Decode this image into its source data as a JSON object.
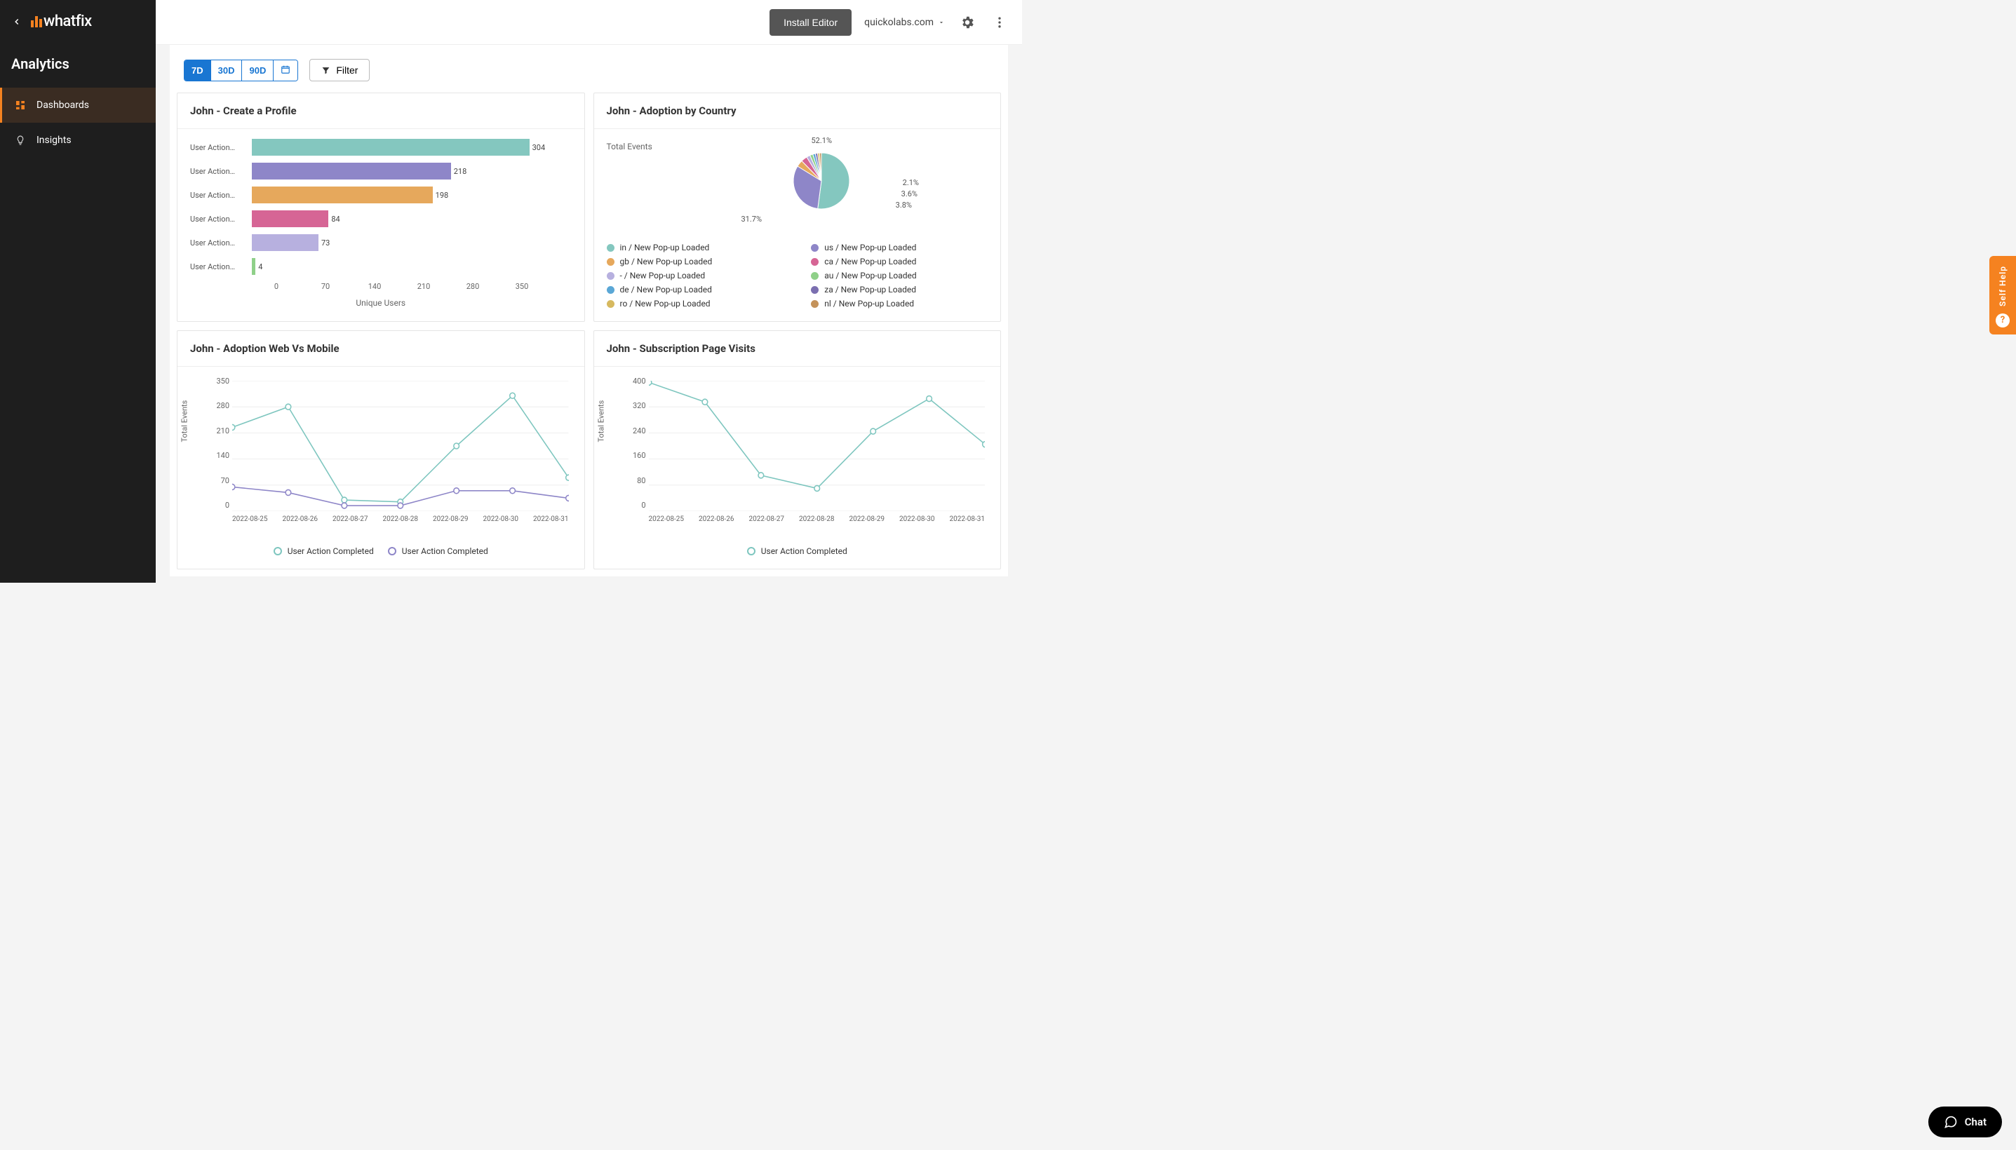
{
  "brand": {
    "name": "whatfix"
  },
  "sidebar": {
    "title": "Analytics",
    "items": [
      {
        "label": "Dashboards",
        "active": true
      },
      {
        "label": "Insights",
        "active": false
      }
    ]
  },
  "topbar": {
    "install_label": "Install Editor",
    "account": "quickolabs.com"
  },
  "filters": {
    "ranges": [
      "7D",
      "30D",
      "90D"
    ],
    "active_range": "7D",
    "filter_label": "Filter"
  },
  "cards": {
    "profile": {
      "title": "John - Create a Profile"
    },
    "country": {
      "title": "John - Adoption by Country",
      "subtitle": "Total Events"
    },
    "webmob": {
      "title": "John - Adoption Web Vs Mobile"
    },
    "subs": {
      "title": "John - Subscription Page Visits"
    }
  },
  "colors": {
    "teal": "#84c7bf",
    "violet": "#8e86c8",
    "orange": "#e6a85c",
    "pink": "#d66595",
    "lilac": "#b7b0df",
    "green": "#8fd089",
    "teal_line": "#7ec6bf",
    "violet_line": "#8e86c8"
  },
  "chart_data": [
    {
      "id": "profile",
      "type": "bar",
      "title": "John - Create a Profile",
      "xlabel": "Unique Users",
      "ylabel": "",
      "xlim": [
        0,
        350
      ],
      "xticks": [
        0,
        70,
        140,
        210,
        280,
        350
      ],
      "category_label": "User Action…",
      "series": [
        {
          "label": "User Action…",
          "value": 304,
          "color": "#84c7bf"
        },
        {
          "label": "User Action…",
          "value": 218,
          "color": "#8e86c8"
        },
        {
          "label": "User Action…",
          "value": 198,
          "color": "#e6a85c"
        },
        {
          "label": "User Action…",
          "value": 84,
          "color": "#d66595"
        },
        {
          "label": "User Action…",
          "value": 73,
          "color": "#b7b0df"
        },
        {
          "label": "User Action…",
          "value": 4,
          "color": "#8fd089"
        }
      ]
    },
    {
      "id": "country",
      "type": "pie",
      "title": "John - Adoption by Country",
      "metric_label": "Total Events",
      "labels_shown": [
        "52.1%",
        "2.1%",
        "3.6%",
        "3.8%",
        "31.7%"
      ],
      "slices": [
        {
          "name": "in / New Pop-up Loaded",
          "pct": 52.1,
          "color": "#84c7bf"
        },
        {
          "name": "us / New Pop-up Loaded",
          "pct": 31.7,
          "color": "#8e86c8"
        },
        {
          "name": "gb / New Pop-up Loaded",
          "pct": 3.8,
          "color": "#e6a85c"
        },
        {
          "name": "ca / New Pop-up Loaded",
          "pct": 3.6,
          "color": "#d66595"
        },
        {
          "name": "- / New Pop-up Loaded",
          "pct": 2.1,
          "color": "#b7b0df"
        },
        {
          "name": "au / New Pop-up Loaded",
          "pct": 1.7,
          "color": "#8fd089"
        },
        {
          "name": "de / New Pop-up Loaded",
          "pct": 1.5,
          "color": "#5aa7d6"
        },
        {
          "name": "za / New Pop-up Loaded",
          "pct": 1.3,
          "color": "#7b6fb0"
        },
        {
          "name": "ro / New Pop-up Loaded",
          "pct": 1.1,
          "color": "#d7b95f"
        },
        {
          "name": "nl / New Pop-up Loaded",
          "pct": 1.1,
          "color": "#c4925a"
        }
      ],
      "legend_order": [
        "in / New Pop-up Loaded",
        "us / New Pop-up Loaded",
        "gb / New Pop-up Loaded",
        "ca / New Pop-up Loaded",
        "- / New Pop-up Loaded",
        "au / New Pop-up Loaded",
        "de / New Pop-up Loaded",
        "za / New Pop-up Loaded",
        "ro / New Pop-up Loaded",
        "nl / New Pop-up Loaded"
      ]
    },
    {
      "id": "webmob",
      "type": "line",
      "title": "John - Adoption Web Vs Mobile",
      "ylabel": "Total Events",
      "ylim": [
        0,
        350
      ],
      "yticks": [
        0,
        70,
        140,
        210,
        280,
        350
      ],
      "x": [
        "2022-08-25",
        "2022-08-26",
        "2022-08-27",
        "2022-08-28",
        "2022-08-29",
        "2022-08-30",
        "2022-08-31"
      ],
      "series": [
        {
          "name": "User Action Completed",
          "color": "#7ec6bf",
          "values": [
            225,
            280,
            30,
            25,
            175,
            310,
            90
          ]
        },
        {
          "name": "User Action Completed",
          "color": "#8e86c8",
          "values": [
            65,
            50,
            15,
            15,
            55,
            55,
            35
          ]
        }
      ]
    },
    {
      "id": "subs",
      "type": "line",
      "title": "John - Subscription Page Visits",
      "ylabel": "Total Events",
      "ylim": [
        0,
        400
      ],
      "yticks": [
        0,
        80,
        160,
        240,
        320,
        400
      ],
      "x": [
        "2022-08-25",
        "2022-08-26",
        "2022-08-27",
        "2022-08-28",
        "2022-08-29",
        "2022-08-30",
        "2022-08-31"
      ],
      "series": [
        {
          "name": "User Action Completed",
          "color": "#7ec6bf",
          "values": [
            395,
            335,
            110,
            70,
            245,
            345,
            205
          ]
        }
      ]
    }
  ],
  "self_help": {
    "label": "Self Help"
  },
  "chat": {
    "label": "Chat"
  }
}
